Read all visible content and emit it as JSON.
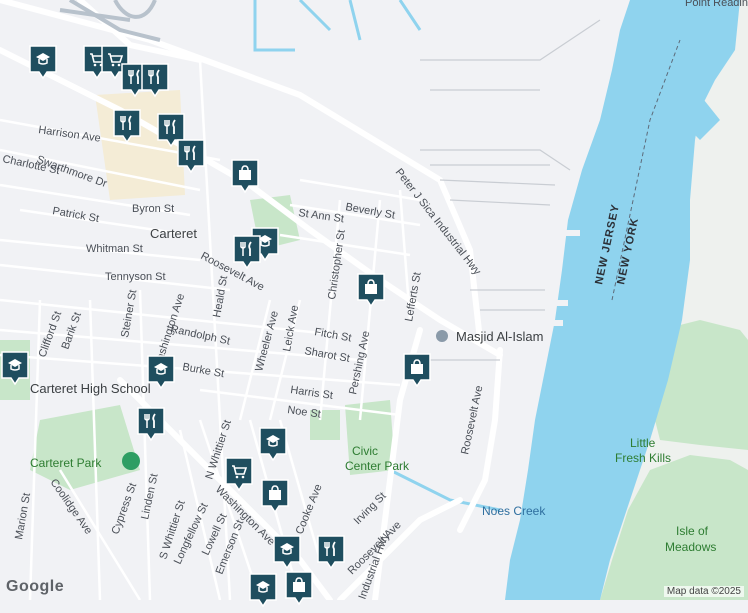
{
  "map": {
    "streets": [
      {
        "name": "Harrison Ave"
      },
      {
        "name": "Charlotte St"
      },
      {
        "name": "Swarthmore Dr"
      },
      {
        "name": "Patrick St"
      },
      {
        "name": "Byron St"
      },
      {
        "name": "Whitman St"
      },
      {
        "name": "Tennyson St"
      },
      {
        "name": "Roosevelt Ave"
      },
      {
        "name": "Washington Ave"
      },
      {
        "name": "Heald St"
      },
      {
        "name": "Randolph St"
      },
      {
        "name": "Burke St"
      },
      {
        "name": "Steiner St"
      },
      {
        "name": "Clifford St"
      },
      {
        "name": "Barik St"
      },
      {
        "name": "St Ann St"
      },
      {
        "name": "Beverly St"
      },
      {
        "name": "Christopher St"
      },
      {
        "name": "Fitch St"
      },
      {
        "name": "Sharot St"
      },
      {
        "name": "Leick Ave"
      },
      {
        "name": "Wheeler Ave"
      },
      {
        "name": "Pershing Ave"
      },
      {
        "name": "Lefferts St"
      },
      {
        "name": "Harris St"
      },
      {
        "name": "Noe St"
      },
      {
        "name": "N Whittier St"
      },
      {
        "name": "S Whittier St"
      },
      {
        "name": "Linden St"
      },
      {
        "name": "Cypress St"
      },
      {
        "name": "Coolidge Ave"
      },
      {
        "name": "Marion St"
      },
      {
        "name": "Longfellow St"
      },
      {
        "name": "Lowell St"
      },
      {
        "name": "Emerson St"
      },
      {
        "name": "Cooke Ave"
      },
      {
        "name": "Irving St"
      },
      {
        "name": "Peter J Sica Industrial Hwy"
      },
      {
        "name": "Industrial Hwy"
      }
    ],
    "places": {
      "town": "Carteret",
      "high_school": "Carteret High School",
      "park": "Carteret Park",
      "civic_park": "Civic Center Park",
      "mosque": "Masjid Al-Islam",
      "creek": "Noes Creek",
      "island1": "Little Fresh Kills",
      "island2": "Isle of Meadows",
      "point": "Point Reading",
      "nj": "NEW JERSEY",
      "ny": "NEW YORK"
    },
    "colors": {
      "water": "#8fd3ee",
      "land": "#f1f2f5",
      "park": "#c8e6c9",
      "road": "#ffffff",
      "pin": "#1f4e5f"
    },
    "pins": [
      {
        "icon": "school-icon"
      },
      {
        "icon": "shopping-cart-icon"
      },
      {
        "icon": "shopping-cart-icon"
      },
      {
        "icon": "restaurant-icon"
      },
      {
        "icon": "restaurant-icon"
      },
      {
        "icon": "restaurant-icon"
      },
      {
        "icon": "restaurant-icon"
      },
      {
        "icon": "shopping-bag-icon"
      },
      {
        "icon": "restaurant-icon"
      },
      {
        "icon": "school-icon"
      },
      {
        "icon": "restaurant-icon"
      },
      {
        "icon": "shopping-bag-icon"
      },
      {
        "icon": "shopping-bag-icon"
      },
      {
        "icon": "school-icon"
      },
      {
        "icon": "school-icon"
      },
      {
        "icon": "restaurant-icon"
      },
      {
        "icon": "school-icon"
      },
      {
        "icon": "shopping-cart-icon"
      },
      {
        "icon": "shopping-bag-icon"
      },
      {
        "icon": "school-icon"
      },
      {
        "icon": "restaurant-icon"
      },
      {
        "icon": "shopping-bag-icon"
      },
      {
        "icon": "school-icon"
      }
    ],
    "logo": "Google",
    "attribution": "Map data ©2025"
  }
}
